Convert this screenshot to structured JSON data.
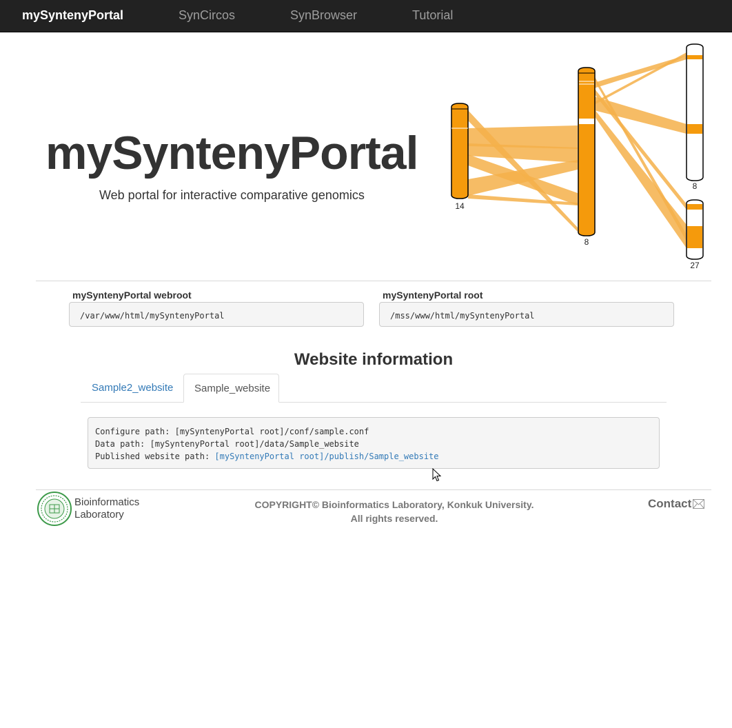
{
  "navbar": {
    "brand": "mySyntenyPortal",
    "links": [
      "SynCircos",
      "SynBrowser",
      "Tutorial"
    ]
  },
  "hero": {
    "title": "mySyntenyPortal",
    "subtitle": "Web portal for interactive comparative genomics",
    "chromosome_labels": [
      "14",
      "8",
      "8",
      "27"
    ]
  },
  "paths": {
    "webroot_label": "mySyntenyPortal webroot",
    "webroot_value": "/var/www/html/mySyntenyPortal",
    "root_label": "mySyntenyPortal root",
    "root_value": "/mss/www/html/mySyntenyPortal"
  },
  "website_info": {
    "title": "Website information",
    "tabs": [
      {
        "label": "Sample2_website",
        "active": false
      },
      {
        "label": "Sample_website",
        "active": true
      }
    ],
    "configure_path": "Configure path: [mySyntenyPortal root]/conf/sample.conf",
    "data_path": "Data path: [mySyntenyPortal root]/data/Sample_website",
    "published_label": "Published website path: ",
    "published_link": "[mySyntenyPortal root]/publish/Sample_website"
  },
  "footer": {
    "lab_line1": "Bioinformatics",
    "lab_line2": "Laboratory",
    "copyright_line1": "COPYRIGHT© Bioinformatics Laboratory, Konkuk University.",
    "copyright_line2": "All rights reserved.",
    "contact": "Contact"
  },
  "icons": {
    "contact": "envelope-icon",
    "logo": "university-seal-logo",
    "cursor": "mouse-pointer"
  },
  "colors": {
    "navbar_bg": "#222222",
    "chromosome_fill": "#f59a0c",
    "synteny_ribbon": "#f5b04a",
    "link": "#337ab7"
  }
}
